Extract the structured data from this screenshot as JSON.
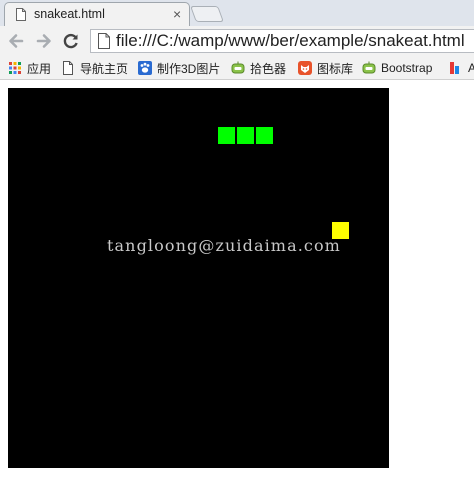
{
  "browser": {
    "tab_title": "snakeat.html",
    "tab_close": "×",
    "address": "file:///C:/wamp/www/ber/example/snakeat.html"
  },
  "bookmarks": [
    {
      "name": "bookmark-apps",
      "label": "应用",
      "icon": "apps-grid-icon"
    },
    {
      "name": "bookmark-home",
      "label": "导航主页",
      "icon": "page-icon"
    },
    {
      "name": "bookmark-3d",
      "label": "制作3D图片",
      "icon": "paw-icon"
    },
    {
      "name": "bookmark-color-picker",
      "label": "拾色器",
      "icon": "robot-icon"
    },
    {
      "name": "bookmark-icon-library",
      "label": "图标库",
      "icon": "fox-icon"
    },
    {
      "name": "bookmark-bootstrap",
      "label": "Bootstrap",
      "icon": "robot-icon"
    },
    {
      "name": "bookmark-overflow",
      "label": "A",
      "icon": "bar-icon"
    }
  ],
  "game": {
    "grid_size": 19,
    "snake": [
      [
        13,
        2
      ],
      [
        12,
        2
      ],
      [
        11,
        2
      ]
    ],
    "food": [
      17,
      7
    ],
    "colors": {
      "snake": "#00ff00",
      "food": "#ffff00",
      "board": "#000000"
    }
  },
  "watermark": "tangloong@zuidaima.com"
}
